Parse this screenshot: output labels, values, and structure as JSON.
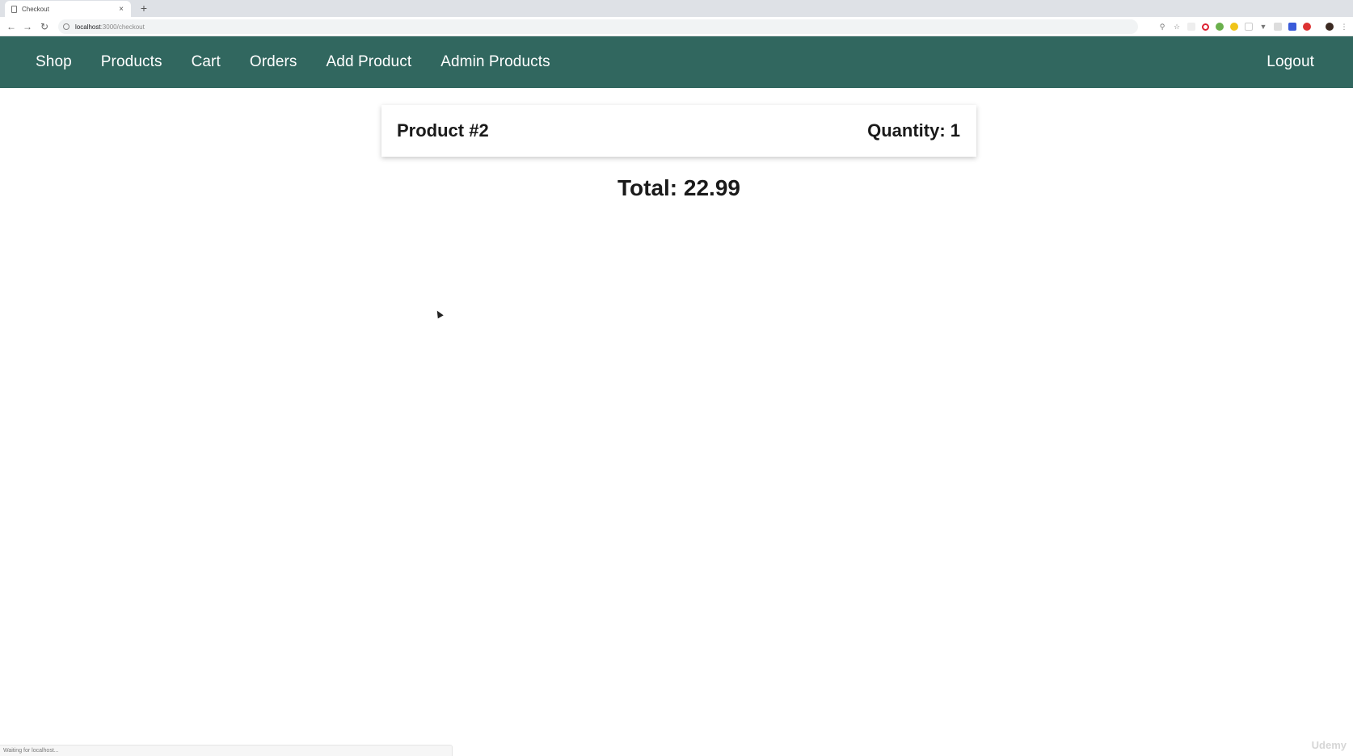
{
  "browser": {
    "tab_title": "Checkout",
    "tab_close": "×",
    "new_tab": "+",
    "url_host": "localhost",
    "url_path": ":3000/checkout",
    "status_text": "Waiting for localhost..."
  },
  "navbar": {
    "items": [
      "Shop",
      "Products",
      "Cart",
      "Orders",
      "Add Product",
      "Admin Products"
    ],
    "logout_label": "Logout",
    "background": "#31675f"
  },
  "checkout": {
    "items": [
      {
        "title": "Product #2",
        "quantity_text": "Quantity: 1"
      }
    ],
    "total_text": "Total: 22.99"
  },
  "watermark": "Udemy"
}
